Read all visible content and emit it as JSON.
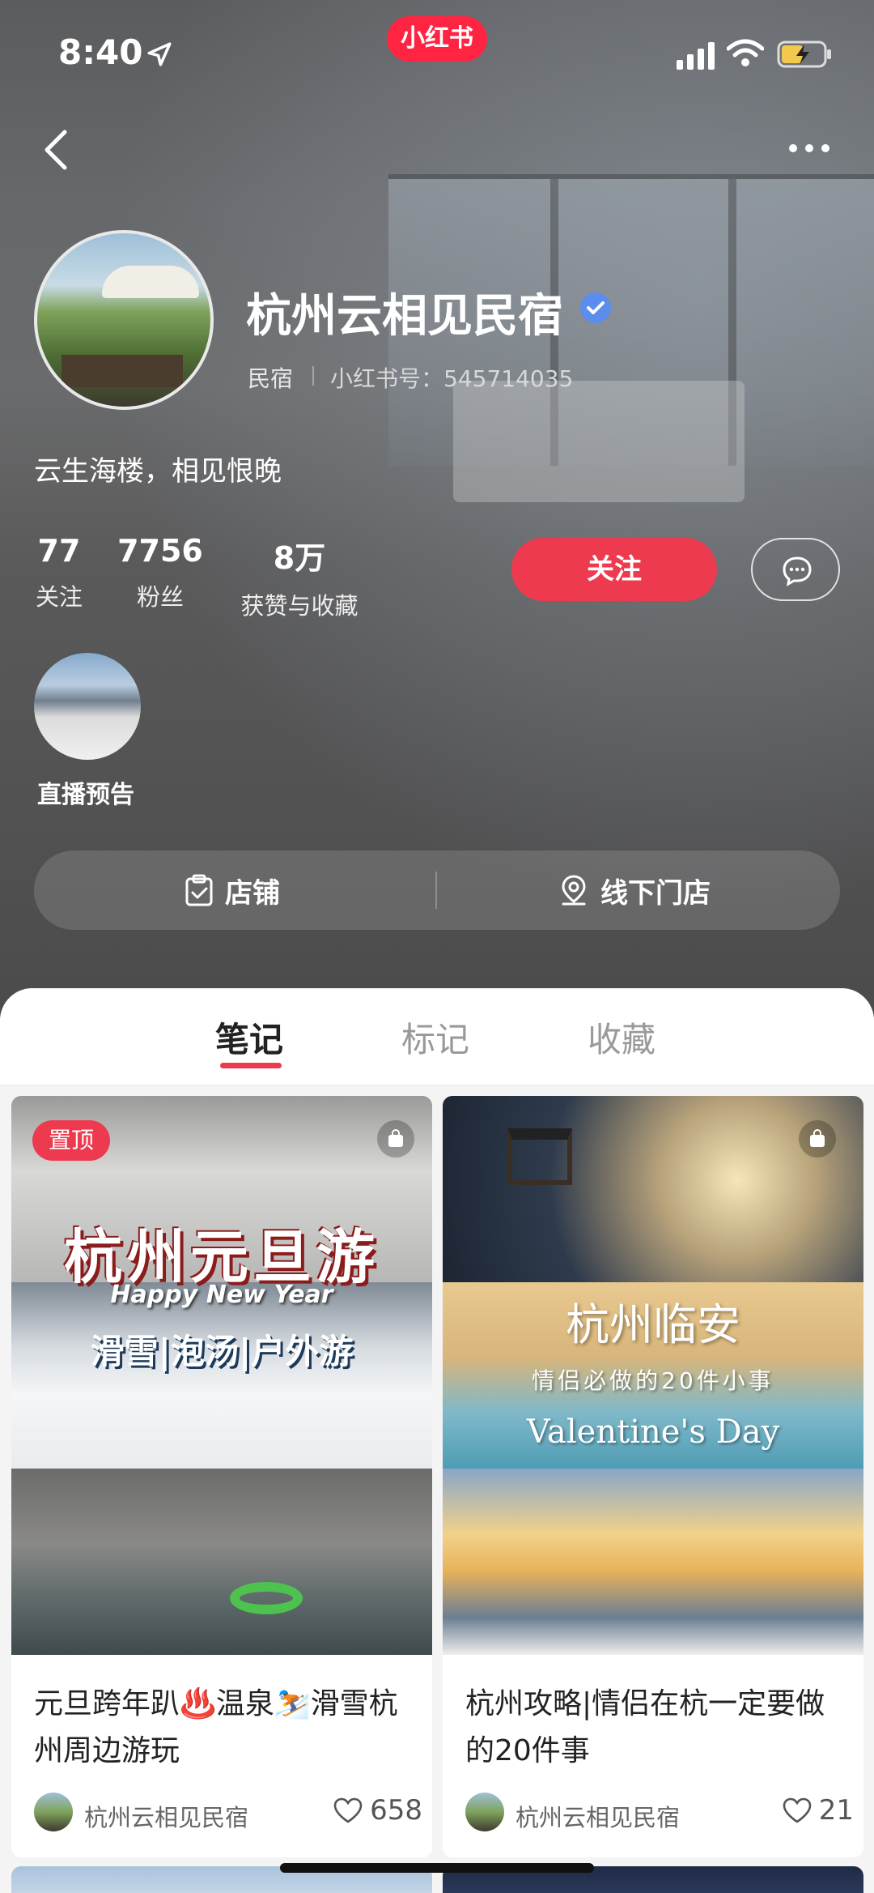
{
  "status_bar": {
    "time": "8:40",
    "app_badge": "小红书"
  },
  "profile": {
    "name": "杭州云相见民宿",
    "category": "民宿",
    "red_id": "小红书号：545714035",
    "bio": "云生海楼，相见恨晚",
    "verified": true
  },
  "stats": {
    "following": {
      "value": "77",
      "label": "关注"
    },
    "fans": {
      "value": "7756",
      "label": "粉丝"
    },
    "likes": {
      "value": "8万",
      "label": "获赞与收藏"
    }
  },
  "actions": {
    "follow_label": "关注"
  },
  "live": {
    "label": "直播预告"
  },
  "shop_bar": {
    "store_label": "店铺",
    "offline_label": "线下门店"
  },
  "tabs": [
    {
      "label": "笔记",
      "active": true
    },
    {
      "label": "标记",
      "active": false
    },
    {
      "label": "收藏",
      "active": false
    }
  ],
  "notes": [
    {
      "pinned_label": "置顶",
      "image_title": "杭州元旦游",
      "image_subtitle_en": "Happy New Year",
      "image_subtitle_cn": "滑雪|泡汤|户外游",
      "title": "元旦跨年趴♨️温泉⛷️滑雪杭州周边游玩",
      "author": "杭州云相见民宿",
      "likes": "658"
    },
    {
      "image_title": "杭州临安",
      "image_subtitle_cn": "情侣必做的20件小事",
      "image_subtitle_en": "Valentine's Day",
      "title": "杭州攻略|情侣在杭一定要做的20件事",
      "author": "杭州云相见民宿",
      "likes": "21"
    }
  ],
  "colors": {
    "brand_red": "#ff2442",
    "follow_red": "#ee3a4f",
    "verified_blue": "#5b8def"
  }
}
